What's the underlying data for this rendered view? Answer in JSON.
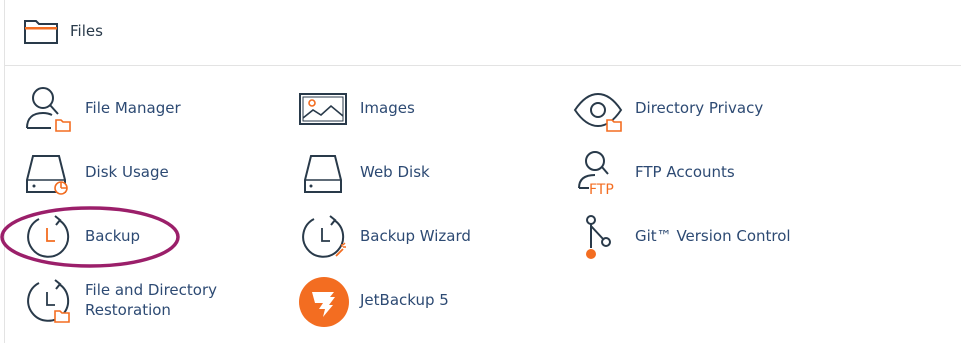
{
  "header": {
    "title": "Files",
    "icon": "folder-icon"
  },
  "colors": {
    "accent": "#f36d21",
    "label": "#2d4a73",
    "icon": "#293a4a",
    "highlight": "#9b1f6a"
  },
  "items": [
    {
      "label": "File Manager",
      "icon": "file-manager-icon"
    },
    {
      "label": "Images",
      "icon": "images-icon"
    },
    {
      "label": "Directory Privacy",
      "icon": "directory-privacy-icon"
    },
    {
      "label": "Disk Usage",
      "icon": "disk-usage-icon"
    },
    {
      "label": "Web Disk",
      "icon": "web-disk-icon"
    },
    {
      "label": "FTP Accounts",
      "icon": "ftp-accounts-icon",
      "icon_text": "FTP"
    },
    {
      "label": "Backup",
      "icon": "backup-icon"
    },
    {
      "label": "Backup Wizard",
      "icon": "backup-wizard-icon"
    },
    {
      "label": "Git™ Version Control",
      "icon": "git-version-control-icon"
    },
    {
      "label": "File and Directory Restoration",
      "icon": "file-directory-restoration-icon"
    },
    {
      "label": "JetBackup 5",
      "icon": "jetbackup-icon"
    }
  ]
}
